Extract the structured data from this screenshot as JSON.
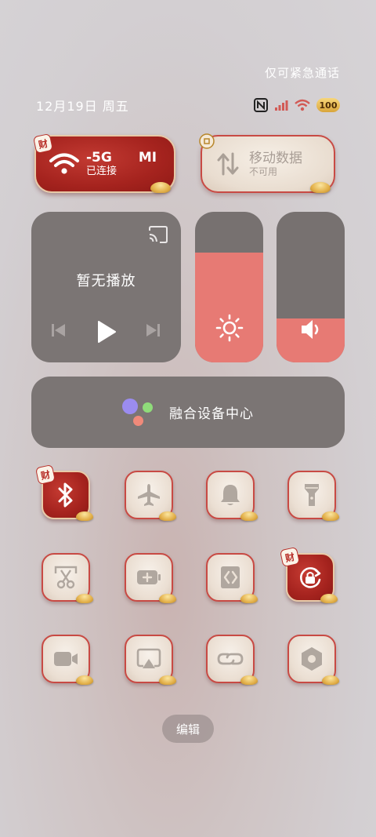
{
  "status": {
    "emergency_text": "仅可紧急通话",
    "date": "12月19日 周五",
    "battery": "100"
  },
  "wifi": {
    "name": "-5G",
    "ssid_suffix": "MI",
    "status": "已连接",
    "badge": "财"
  },
  "mobile_data": {
    "title": "移动数据",
    "status": "不可用"
  },
  "media": {
    "title": "暂无播放"
  },
  "brightness": {
    "level": 0.73
  },
  "volume": {
    "level": 0.29
  },
  "device_hub": {
    "label": "融合设备中心"
  },
  "tiles": [
    {
      "name": "bluetooth-icon",
      "active": true,
      "badge": "财"
    },
    {
      "name": "airplane-icon",
      "active": false
    },
    {
      "name": "bell-icon",
      "active": false
    },
    {
      "name": "flashlight-icon",
      "active": false
    },
    {
      "name": "screenshot-scissors-icon",
      "active": false
    },
    {
      "name": "battery-saver-icon",
      "active": false
    },
    {
      "name": "cast-arrows-icon",
      "active": false
    },
    {
      "name": "rotation-lock-icon",
      "active": true,
      "badge": "财"
    },
    {
      "name": "video-camera-icon",
      "active": false
    },
    {
      "name": "screen-mirror-icon",
      "active": false
    },
    {
      "name": "link-icon",
      "active": false
    },
    {
      "name": "settings-hex-icon",
      "active": false
    }
  ],
  "edit_label": "编辑",
  "colors": {
    "accent_red": "#a5231e",
    "slider_fill": "#e77a74",
    "card_grey": "#7b7574"
  }
}
